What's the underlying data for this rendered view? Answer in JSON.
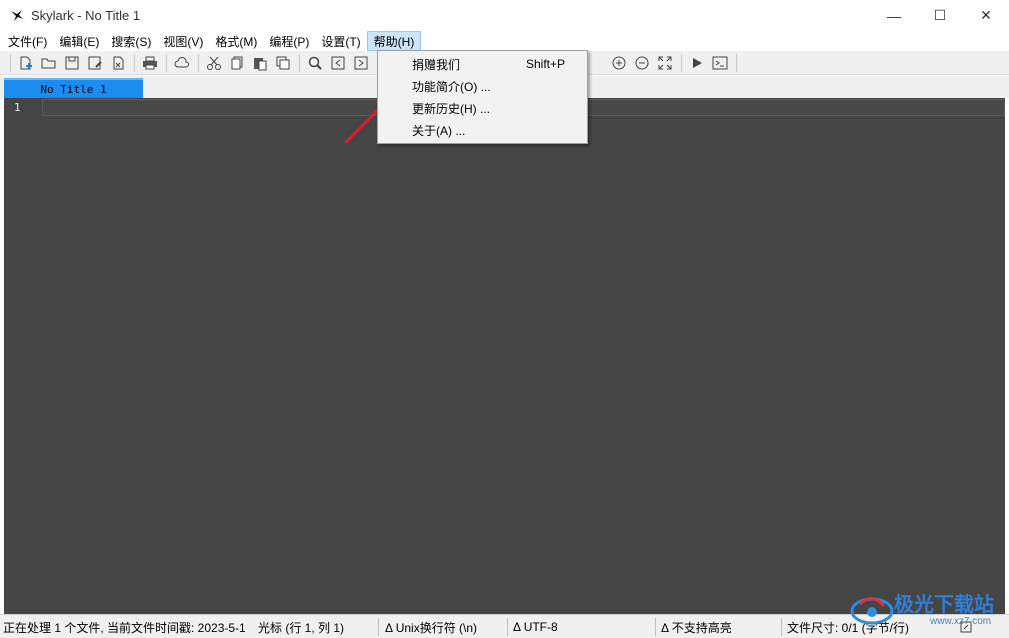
{
  "window": {
    "title": "Skylark - No Title 1",
    "controls": {
      "minimize": "—",
      "maximize": "☐",
      "close": "✕"
    }
  },
  "menubar": {
    "items": [
      {
        "label": "文件(F)",
        "name": "menu-file"
      },
      {
        "label": "编辑(E)",
        "name": "menu-edit"
      },
      {
        "label": "搜索(S)",
        "name": "menu-search"
      },
      {
        "label": "视图(V)",
        "name": "menu-view"
      },
      {
        "label": "格式(M)",
        "name": "menu-format"
      },
      {
        "label": "编程(P)",
        "name": "menu-programming"
      },
      {
        "label": "设置(T)",
        "name": "menu-settings"
      },
      {
        "label": "帮助(H)",
        "name": "menu-help"
      }
    ],
    "active": "帮助(H)"
  },
  "help_menu": {
    "items": [
      {
        "label": "捐赠我们",
        "shortcut": "Shift+P"
      },
      {
        "label": "功能简介(O) ...",
        "shortcut": ""
      },
      {
        "label": "更新历史(H) ...",
        "shortcut": ""
      },
      {
        "label": "关于(A) ...",
        "shortcut": ""
      }
    ]
  },
  "toolbar": {
    "icons": [
      "new-file-icon",
      "open-folder-icon",
      "save-icon",
      "save-as-icon",
      "export-icon",
      "print-icon",
      "cloud-icon",
      "cut-icon",
      "copy-icon",
      "paste-icon",
      "clipboard-icon",
      "find-icon",
      "prev-icon",
      "next-icon",
      "back-icon",
      "zoom-in-icon",
      "zoom-out-icon",
      "fullscreen-icon",
      "run-icon",
      "terminal-icon"
    ]
  },
  "tabs": [
    {
      "label": "No Title 1",
      "active": true
    }
  ],
  "editor": {
    "line_numbers": [
      "1"
    ]
  },
  "statusbar": {
    "processing": "正在处理 1 个文件, 当前文件时间戳: 2023-5-1",
    "cursor": "光标 (行 1, 列 1)",
    "line_ending": "Δ Unix换行符 (\\n)",
    "encoding": "Δ UTF-8",
    "highlight": "Δ 不支持高亮",
    "file_size": "文件尺寸: 0/1 (字节/行)"
  },
  "watermark": {
    "text": "极光下载站",
    "url_text": "www.xz7.com"
  },
  "colors": {
    "editor_bg": "#454545",
    "tab_active": "#1c8cf0",
    "menu_active": "#cce4f7",
    "arrow": "#e02020"
  }
}
